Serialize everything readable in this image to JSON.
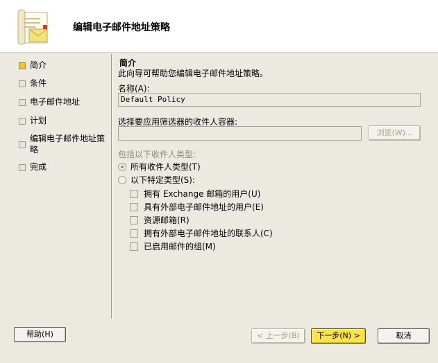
{
  "header": {
    "title": "编辑电子邮件地址策略"
  },
  "nav": {
    "items": [
      {
        "label": "简介",
        "active": true
      },
      {
        "label": "条件",
        "active": false
      },
      {
        "label": "电子邮件地址",
        "active": false
      },
      {
        "label": "计划",
        "active": false
      },
      {
        "label": "编辑电子邮件地址策略",
        "active": false
      },
      {
        "label": "完成",
        "active": false
      }
    ]
  },
  "main": {
    "section_title": "简介",
    "description": "此向导可帮助您编辑电子邮件地址策略。",
    "name_label": "名称(A):",
    "name_value": "Default Policy",
    "container_label": "选择要应用筛选器的收件人容器:",
    "container_value": "",
    "browse_button": "浏览(W)...",
    "recipient_types_label": "包括以下收件人类型:",
    "radio_all": "所有收件人类型(T)",
    "radio_specific": "以下特定类型(S):",
    "checkboxes": [
      "拥有 Exchange 邮箱的用户(U)",
      "具有外部电子邮件地址的用户(E)",
      "资源邮箱(R)",
      "拥有外部电子邮件地址的联系人(C)",
      "已启用邮件的组(M)"
    ]
  },
  "footer": {
    "help": "帮助(H)",
    "back": "< 上一步(B)",
    "next": "下一步(N) >",
    "cancel": "取消"
  },
  "colors": {
    "background": "#ece9e0",
    "next_button": "#f8e24e",
    "active_bullet": "#f3c533"
  }
}
